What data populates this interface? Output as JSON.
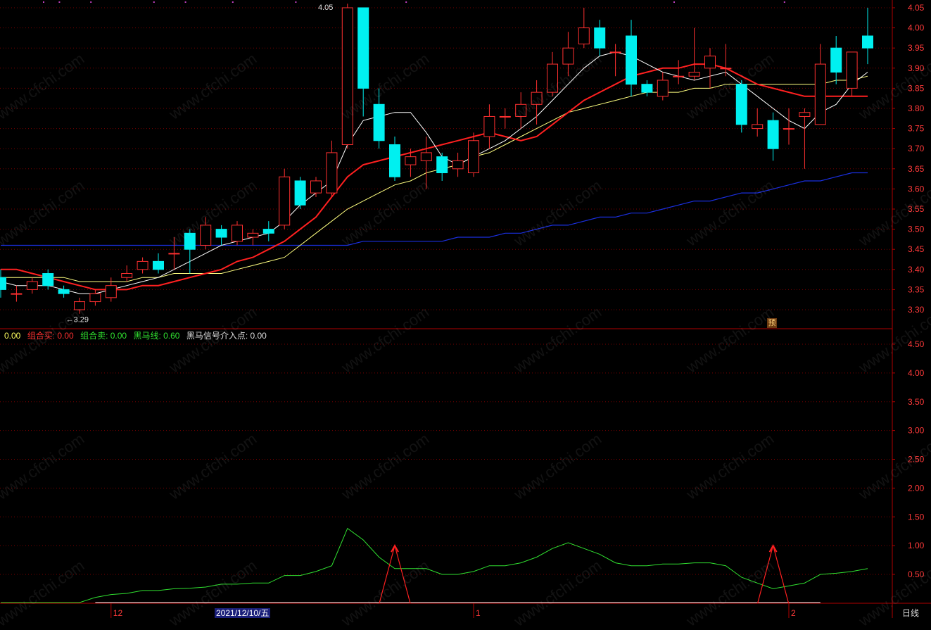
{
  "colors": {
    "up": "#ff3030",
    "down": "#00f0f0",
    "grid": "#7a0000",
    "axis": "#b00000",
    "axis_text": "#ff3a3a",
    "ma5": "#ffffff",
    "ma10": "#ff2020",
    "ma20": "#ffff80",
    "ma60": "#1a2fe0",
    "indicator": "#30e030",
    "signal": "#ff2020"
  },
  "indicator_legend": {
    "first_value": "0.00",
    "buy_label": "组合买: 0.00",
    "sell_label": "组合卖: 0.00",
    "horse_label": "黑马线: 0.60",
    "signal_label": "黑马信号介入点: 0.00"
  },
  "badges": {
    "pre": "预",
    "period": "日线",
    "date": "2021/12/10/五"
  },
  "chart_data": [
    {
      "type": "candlestick",
      "yticks": [
        "4.05",
        "4.00",
        "3.95",
        "3.90",
        "3.85",
        "3.80",
        "3.75",
        "3.70",
        "3.65",
        "3.60",
        "3.55",
        "3.50",
        "3.45",
        "3.40",
        "3.35",
        "3.30"
      ],
      "ylim": [
        3.24,
        4.06
      ],
      "annotations": [
        {
          "text": "←3.29",
          "index": 4,
          "value": 3.29
        },
        {
          "text": "4.05",
          "index": 20,
          "value": 4.05
        }
      ],
      "candles": [
        [
          3.38,
          3.35,
          3.4,
          3.33
        ],
        [
          3.34,
          3.34,
          3.36,
          3.32
        ],
        [
          3.35,
          3.37,
          3.38,
          3.34
        ],
        [
          3.39,
          3.36,
          3.4,
          3.35
        ],
        [
          3.35,
          3.34,
          3.36,
          3.33
        ],
        [
          3.3,
          3.32,
          3.33,
          3.29
        ],
        [
          3.32,
          3.34,
          3.35,
          3.31
        ],
        [
          3.33,
          3.36,
          3.38,
          3.32
        ],
        [
          3.38,
          3.39,
          3.41,
          3.37
        ],
        [
          3.4,
          3.42,
          3.43,
          3.39
        ],
        [
          3.42,
          3.4,
          3.44,
          3.39
        ],
        [
          3.44,
          3.44,
          3.48,
          3.4
        ],
        [
          3.49,
          3.45,
          3.5,
          3.39
        ],
        [
          3.46,
          3.51,
          3.53,
          3.45
        ],
        [
          3.5,
          3.48,
          3.51,
          3.46
        ],
        [
          3.47,
          3.51,
          3.52,
          3.46
        ],
        [
          3.48,
          3.49,
          3.5,
          3.46
        ],
        [
          3.5,
          3.49,
          3.52,
          3.47
        ],
        [
          3.51,
          3.63,
          3.65,
          3.5
        ],
        [
          3.62,
          3.56,
          3.63,
          3.55
        ],
        [
          3.59,
          3.62,
          3.63,
          3.58
        ],
        [
          3.59,
          3.69,
          3.72,
          3.58
        ],
        [
          3.71,
          4.05,
          4.06,
          3.7
        ],
        [
          4.05,
          3.85,
          4.05,
          3.78
        ],
        [
          3.81,
          3.72,
          3.85,
          3.7
        ],
        [
          3.71,
          3.63,
          3.73,
          3.62
        ],
        [
          3.66,
          3.68,
          3.7,
          3.63
        ],
        [
          3.67,
          3.69,
          3.73,
          3.6
        ],
        [
          3.68,
          3.64,
          3.69,
          3.62
        ],
        [
          3.65,
          3.67,
          3.69,
          3.63
        ],
        [
          3.64,
          3.72,
          3.74,
          3.63
        ],
        [
          3.73,
          3.78,
          3.81,
          3.7
        ],
        [
          3.78,
          3.78,
          3.8,
          3.75
        ],
        [
          3.78,
          3.81,
          3.84,
          3.75
        ],
        [
          3.81,
          3.84,
          3.87,
          3.76
        ],
        [
          3.84,
          3.91,
          3.94,
          3.83
        ],
        [
          3.91,
          3.95,
          3.99,
          3.88
        ],
        [
          3.96,
          4.0,
          4.05,
          3.95
        ],
        [
          4.0,
          3.95,
          4.02,
          3.93
        ],
        [
          3.94,
          3.94,
          3.96,
          3.88
        ],
        [
          3.98,
          3.86,
          4.02,
          3.83
        ],
        [
          3.86,
          3.84,
          3.87,
          3.83
        ],
        [
          3.83,
          3.87,
          3.89,
          3.82
        ],
        [
          3.88,
          3.88,
          3.92,
          3.86
        ],
        [
          3.88,
          3.89,
          4.0,
          3.87
        ],
        [
          3.9,
          3.93,
          3.95,
          3.85
        ],
        [
          3.9,
          3.9,
          3.96,
          3.88
        ],
        [
          3.86,
          3.76,
          3.87,
          3.74
        ],
        [
          3.75,
          3.76,
          3.8,
          3.73
        ],
        [
          3.77,
          3.7,
          3.79,
          3.67
        ],
        [
          3.75,
          3.75,
          3.8,
          3.71
        ],
        [
          3.78,
          3.79,
          3.8,
          3.65
        ],
        [
          3.76,
          3.91,
          3.96,
          3.76
        ],
        [
          3.95,
          3.89,
          3.98,
          3.86
        ],
        [
          3.85,
          3.94,
          3.94,
          3.83
        ],
        [
          3.98,
          3.95,
          4.05,
          3.91
        ]
      ],
      "ma5": [
        3.37,
        3.36,
        3.36,
        3.36,
        3.35,
        3.34,
        3.34,
        3.35,
        3.36,
        3.37,
        3.38,
        3.4,
        3.42,
        3.44,
        3.46,
        3.47,
        3.48,
        3.49,
        3.52,
        3.56,
        3.59,
        3.62,
        3.71,
        3.77,
        3.78,
        3.79,
        3.79,
        3.74,
        3.68,
        3.66,
        3.68,
        3.7,
        3.72,
        3.75,
        3.78,
        3.82,
        3.86,
        3.9,
        3.93,
        3.94,
        3.93,
        3.91,
        3.89,
        3.88,
        3.87,
        3.88,
        3.89,
        3.86,
        3.83,
        3.8,
        3.77,
        3.75,
        3.79,
        3.81,
        3.86,
        3.89
      ],
      "ma10": [
        3.4,
        3.4,
        3.39,
        3.38,
        3.37,
        3.36,
        3.35,
        3.35,
        3.35,
        3.36,
        3.36,
        3.37,
        3.38,
        3.39,
        3.4,
        3.42,
        3.43,
        3.45,
        3.47,
        3.5,
        3.53,
        3.58,
        3.63,
        3.66,
        3.67,
        3.68,
        3.69,
        3.7,
        3.71,
        3.72,
        3.73,
        3.74,
        3.73,
        3.72,
        3.73,
        3.76,
        3.79,
        3.82,
        3.84,
        3.86,
        3.88,
        3.89,
        3.9,
        3.9,
        3.91,
        3.91,
        3.9,
        3.88,
        3.86,
        3.85,
        3.84,
        3.83,
        3.83,
        3.83,
        3.83,
        3.83
      ],
      "ma20": [
        3.38,
        3.38,
        3.38,
        3.38,
        3.38,
        3.37,
        3.37,
        3.37,
        3.37,
        3.38,
        3.38,
        3.39,
        3.39,
        3.39,
        3.39,
        3.4,
        3.41,
        3.42,
        3.43,
        3.46,
        3.49,
        3.52,
        3.55,
        3.57,
        3.59,
        3.61,
        3.62,
        3.64,
        3.65,
        3.66,
        3.68,
        3.69,
        3.71,
        3.73,
        3.75,
        3.77,
        3.79,
        3.8,
        3.81,
        3.82,
        3.83,
        3.84,
        3.84,
        3.84,
        3.85,
        3.85,
        3.86,
        3.86,
        3.86,
        3.86,
        3.86,
        3.86,
        3.86,
        3.87,
        3.87,
        3.88
      ],
      "ma60": [
        3.46,
        3.46,
        3.46,
        3.46,
        3.46,
        3.46,
        3.46,
        3.46,
        3.46,
        3.46,
        3.46,
        3.46,
        3.46,
        3.46,
        3.46,
        3.46,
        3.46,
        3.46,
        3.46,
        3.46,
        3.46,
        3.46,
        3.46,
        3.47,
        3.47,
        3.47,
        3.47,
        3.47,
        3.47,
        3.48,
        3.48,
        3.48,
        3.49,
        3.49,
        3.5,
        3.51,
        3.51,
        3.52,
        3.53,
        3.53,
        3.54,
        3.54,
        3.55,
        3.56,
        3.57,
        3.57,
        3.58,
        3.59,
        3.59,
        3.6,
        3.61,
        3.62,
        3.62,
        3.63,
        3.64,
        3.64
      ]
    },
    {
      "type": "line",
      "yticks": [
        "4.50",
        "4.00",
        "3.50",
        "3.00",
        "2.50",
        "2.00",
        "1.50",
        "1.00",
        "0.50"
      ],
      "ylim": [
        0.0,
        4.75
      ],
      "horse_line": [
        0.0,
        0.0,
        0.0,
        0.0,
        0.0,
        0.0,
        0.1,
        0.15,
        0.17,
        0.22,
        0.22,
        0.25,
        0.26,
        0.28,
        0.33,
        0.33,
        0.35,
        0.35,
        0.48,
        0.48,
        0.55,
        0.65,
        1.3,
        1.1,
        0.8,
        0.6,
        0.6,
        0.6,
        0.5,
        0.5,
        0.55,
        0.65,
        0.65,
        0.7,
        0.8,
        0.95,
        1.05,
        0.95,
        0.85,
        0.7,
        0.65,
        0.65,
        0.68,
        0.68,
        0.7,
        0.7,
        0.65,
        0.45,
        0.35,
        0.25,
        0.3,
        0.35,
        0.5,
        0.52,
        0.55,
        0.6
      ],
      "signals": [
        25,
        49
      ]
    }
  ],
  "x_labels": [
    {
      "text": "12",
      "index": 7
    },
    {
      "text": "1",
      "index": 30
    },
    {
      "text": "2",
      "index": 50
    }
  ],
  "watermark": "www.cfchi.com"
}
